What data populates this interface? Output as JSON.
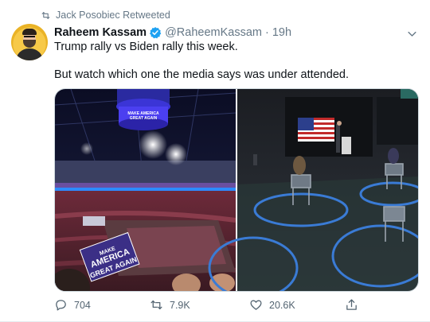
{
  "retweet": {
    "label": "Jack Posobiec Retweeted",
    "icon": "retweet-icon"
  },
  "author": {
    "name": "Raheem Kassam",
    "handle": "@RaheemKassam",
    "time": "19h",
    "verified_icon": "verified-badge-icon"
  },
  "tweet": {
    "line1": "Trump rally vs Biden rally this week.",
    "line2": "But watch which one the media says was under attended."
  },
  "media": {
    "left_image": {
      "sign_text": "MAKE AMERICA GREAT AGAIN",
      "scoreboard_text": "MAKE AMERICA GREAT AGAIN"
    },
    "right_image": {}
  },
  "actions": {
    "reply_count": "704",
    "retweet_count": "7.9K",
    "like_count": "20.6K"
  },
  "colors": {
    "accent": "#1da1f2",
    "muted": "#657786"
  }
}
